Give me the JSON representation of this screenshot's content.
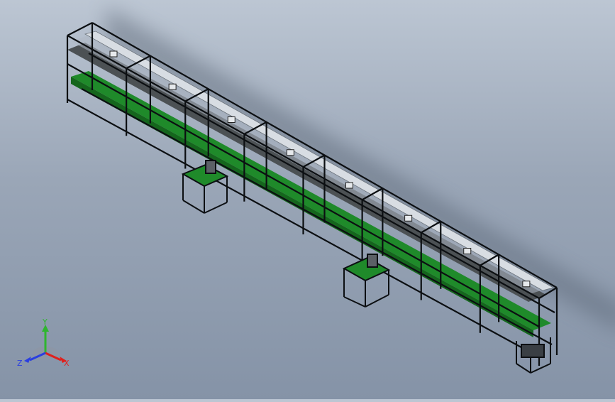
{
  "triad": {
    "x_label": "X",
    "y_label": "Y",
    "z_label": "Z",
    "x_color": "#e0201c",
    "y_color": "#2fb52f",
    "z_color": "#2a3fe0"
  },
  "scene": {
    "frame_color": "#0c0f12",
    "belt_color": "#1f8a2a",
    "top_belt_color": "#4a4f52",
    "glass_color": "#aeb8c4"
  }
}
